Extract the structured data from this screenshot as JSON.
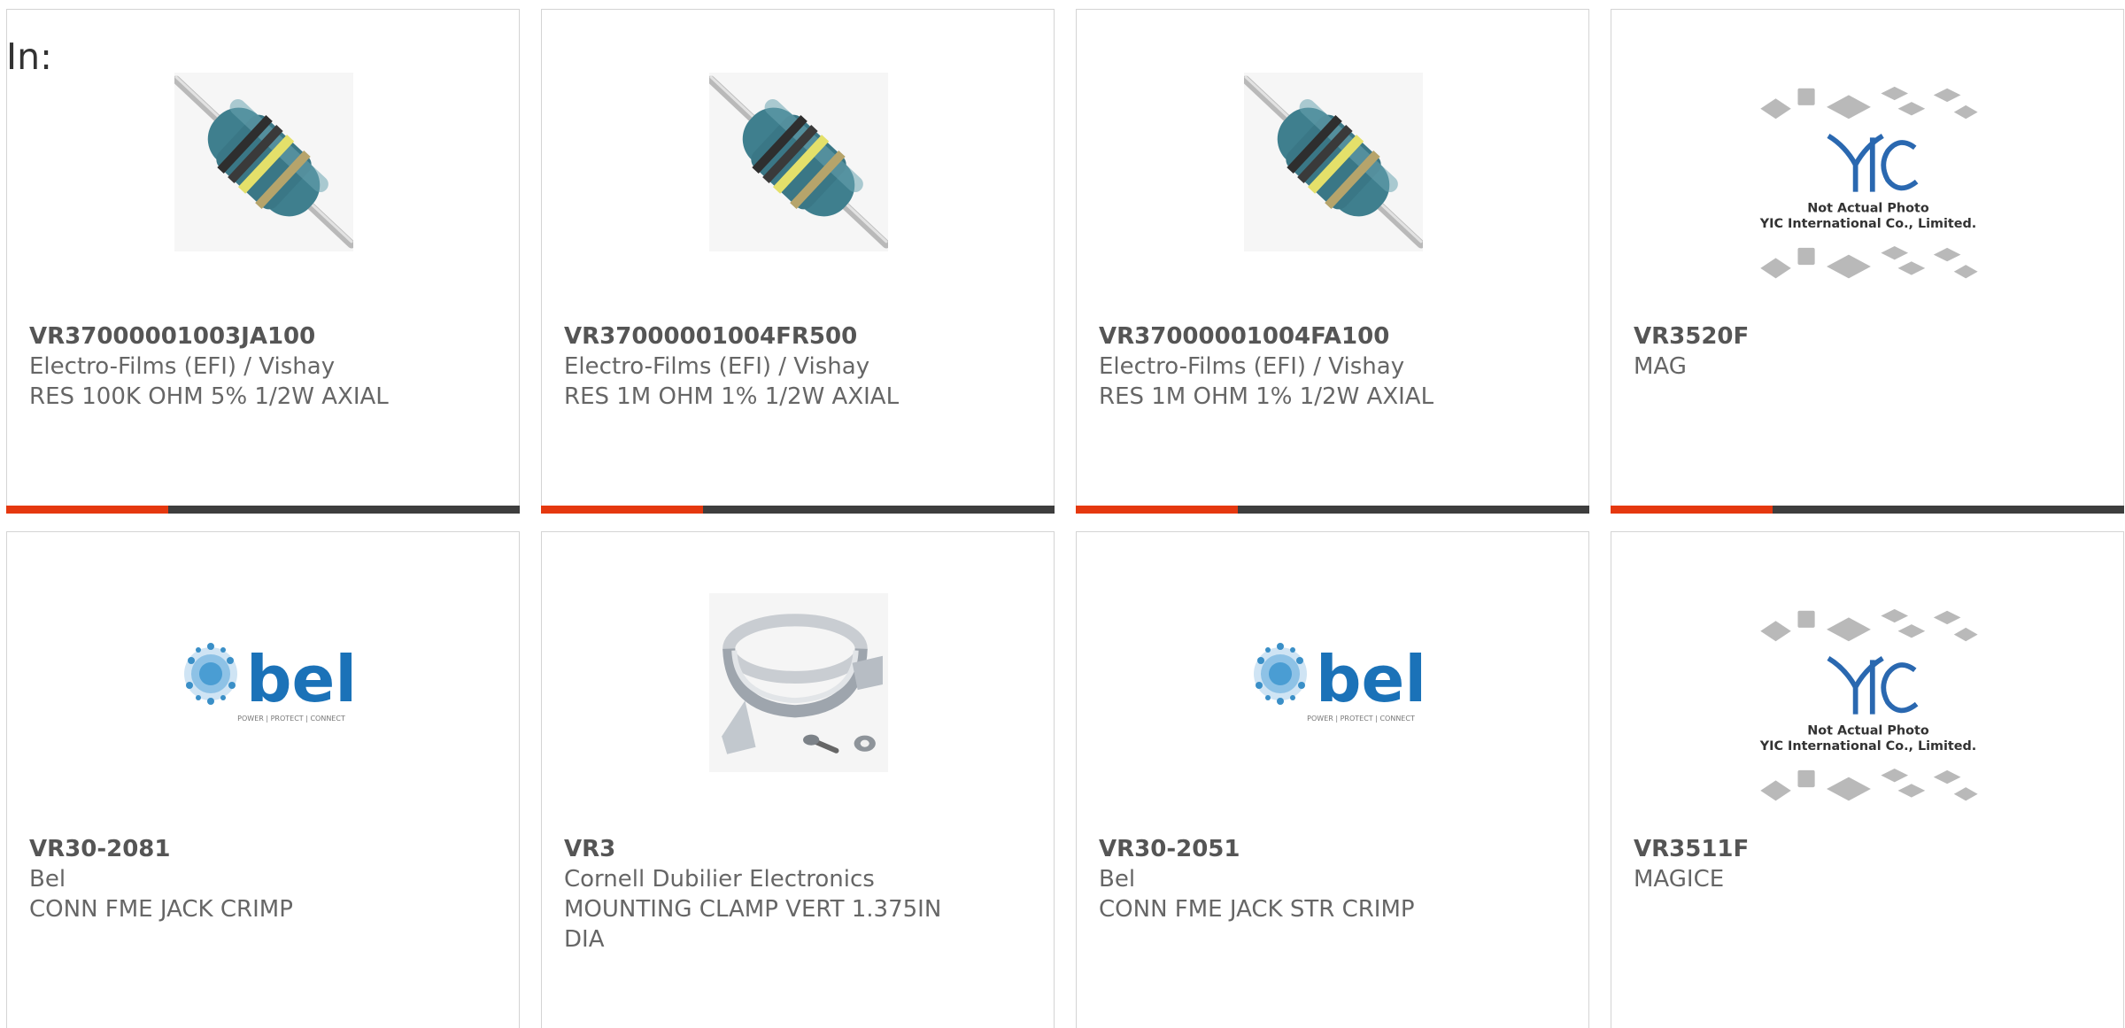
{
  "page": {
    "heading": "In:"
  },
  "colors": {
    "accent": "#e5380f",
    "bar": "#3e3e3e",
    "border": "#d4d4d4",
    "text": "#666666"
  },
  "products": [
    {
      "part_number": "VR37000001003JA100",
      "manufacturer": "Electro-Films (EFI) / Vishay",
      "description": "RES 100K OHM 5% 1/2W AXIAL",
      "image": "axial-resistor-image"
    },
    {
      "part_number": "VR37000001004FR500",
      "manufacturer": "Electro-Films (EFI) / Vishay",
      "description": "RES 1M OHM 1% 1/2W AXIAL",
      "image": "axial-resistor-image"
    },
    {
      "part_number": "VR37000001004FA100",
      "manufacturer": "Electro-Films (EFI) / Vishay",
      "description": "RES 1M OHM 1% 1/2W AXIAL",
      "image": "axial-resistor-image"
    },
    {
      "part_number": "VR3520F",
      "manufacturer": "MAG",
      "description": "",
      "image": "yic-placeholder-image",
      "placeholder_caption": [
        "Not Actual Photo",
        "YIC International Co., Limited."
      ]
    },
    {
      "part_number": "VR30-2081",
      "manufacturer": "Bel",
      "description": "CONN FME JACK CRIMP",
      "image": "bel-logo-image",
      "logo": {
        "word": "bel",
        "tagline": "POWER | PROTECT | CONNECT"
      }
    },
    {
      "part_number": "VR3",
      "manufacturer": "Cornell Dubilier Electronics",
      "description": "MOUNTING CLAMP VERT 1.375IN DIA",
      "image": "mounting-clamp-image"
    },
    {
      "part_number": "VR30-2051",
      "manufacturer": "Bel",
      "description": "CONN FME JACK STR CRIMP",
      "image": "bel-logo-image",
      "logo": {
        "word": "bel",
        "tagline": "POWER | PROTECT | CONNECT"
      }
    },
    {
      "part_number": "VR3511F",
      "manufacturer": "MAGICE",
      "description": "",
      "image": "yic-placeholder-image",
      "placeholder_caption": [
        "Not Actual Photo",
        "YIC International Co., Limited."
      ]
    }
  ]
}
